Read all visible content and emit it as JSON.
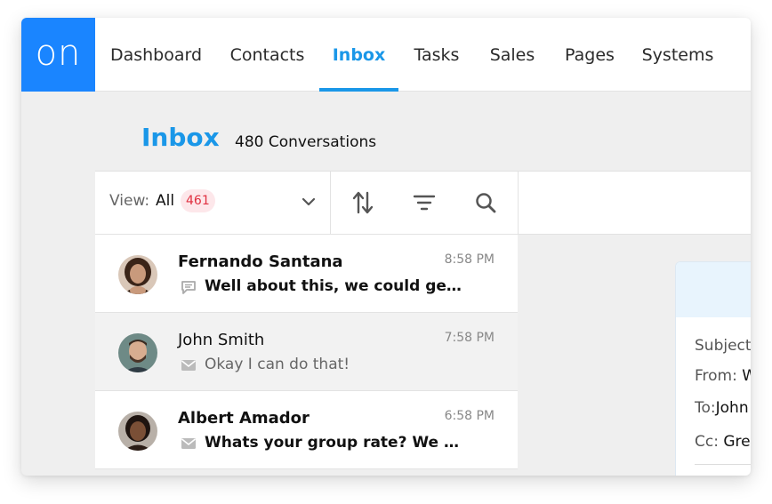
{
  "app": {
    "logo_text": "on",
    "brand_color": "#1a85ff",
    "accent_color": "#1a97e8"
  },
  "nav": {
    "items": [
      {
        "label": "Dashboard"
      },
      {
        "label": "Contacts"
      },
      {
        "label": "Inbox",
        "active": true
      },
      {
        "label": "Tasks"
      },
      {
        "label": "Sales"
      },
      {
        "label": "Pages"
      },
      {
        "label": "Systems"
      }
    ]
  },
  "page": {
    "title": "Inbox",
    "count": "480 Conversations"
  },
  "toolbar": {
    "view_label": "View:",
    "view_value": "All",
    "view_badge": "461",
    "icons": [
      "sort-icon",
      "filter-icon",
      "search-icon"
    ]
  },
  "conversations": [
    {
      "name": "Fernando Santana",
      "time": "8:58 PM",
      "preview": "Well about this, we could get ...",
      "unread": true,
      "icon": "chat-icon"
    },
    {
      "name": "John Smith",
      "time": "7:58 PM",
      "preview": "Okay I can do that!",
      "unread": false,
      "icon": "mail-icon"
    },
    {
      "name": "Albert Amador",
      "time": "6:58 PM",
      "preview": "Whats your group rate? We a ...",
      "unread": true,
      "icon": "mail-icon"
    }
  ],
  "detail": {
    "subject_label": "Subject",
    "from_label": "From:",
    "from_value": "W",
    "to_label": "To:",
    "to_value": "John",
    "cc_label": "Cc:",
    "cc_value": "Gre"
  }
}
